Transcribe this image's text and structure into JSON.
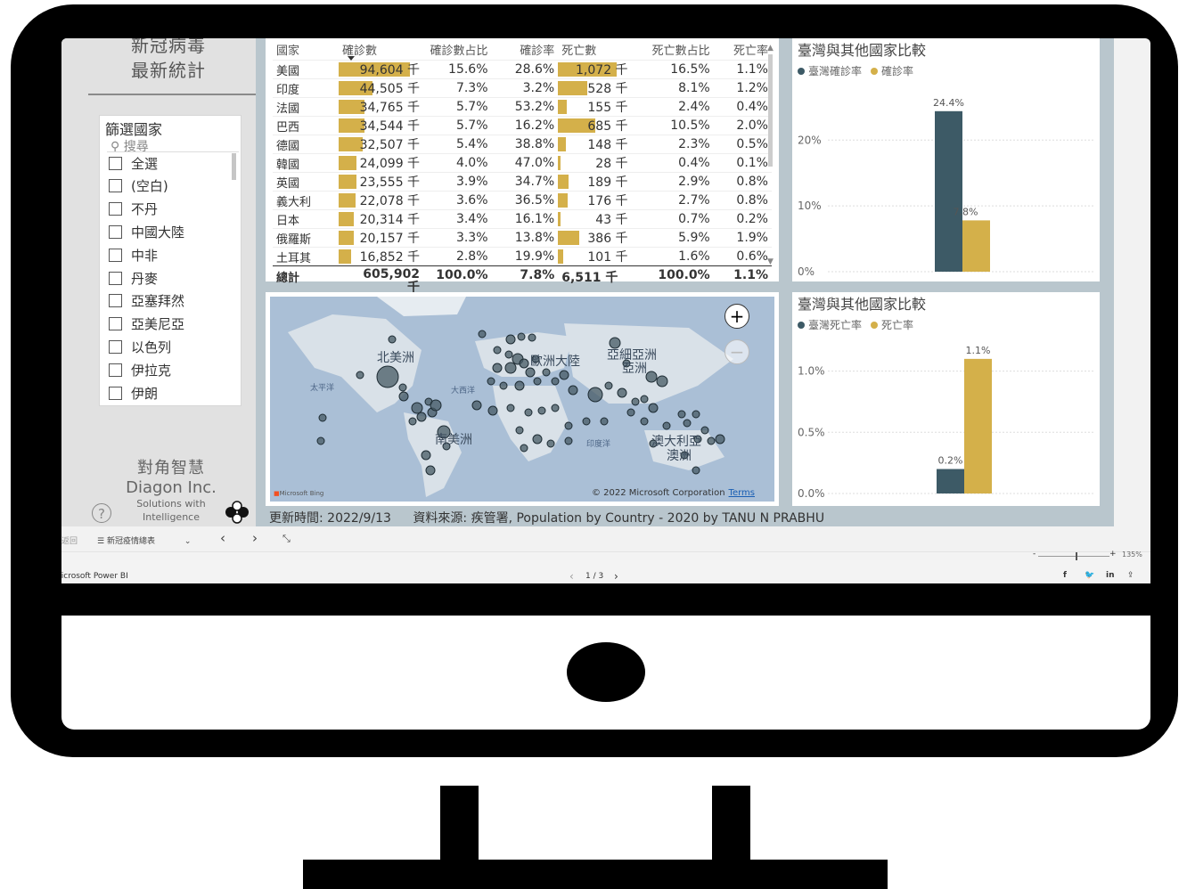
{
  "header": {
    "title_line1": "新冠病毒",
    "title_line2": "最新統計"
  },
  "slicer": {
    "title": "篩選國家",
    "search_placeholder": "搜尋",
    "items": [
      "全選",
      "(空白)",
      "不丹",
      "中國大陸",
      "中非",
      "丹麥",
      "亞塞拜然",
      "亞美尼亞",
      "以色列",
      "伊拉克",
      "伊朗"
    ]
  },
  "brand": {
    "cn": "對角智慧",
    "en": "Diagon Inc.",
    "tag1": "Solutions with",
    "tag2": "Intelligence"
  },
  "table": {
    "headers": [
      "國家",
      "確診數",
      "確診數占比",
      "確診率",
      "死亡數",
      "死亡數占比",
      "死亡率"
    ],
    "rows": [
      {
        "country": "美國",
        "cases": "94,604 千",
        "cases_pct": "15.6%",
        "case_rate": "28.6%",
        "deaths": "1,072 千",
        "deaths_pct": "16.5%",
        "death_rate": "1.1%",
        "cases_num": 94604,
        "deaths_num": 1072
      },
      {
        "country": "印度",
        "cases": "44,505 千",
        "cases_pct": "7.3%",
        "case_rate": "3.2%",
        "deaths": "528 千",
        "deaths_pct": "8.1%",
        "death_rate": "1.2%",
        "cases_num": 44505,
        "deaths_num": 528
      },
      {
        "country": "法國",
        "cases": "34,765 千",
        "cases_pct": "5.7%",
        "case_rate": "53.2%",
        "deaths": "155 千",
        "deaths_pct": "2.4%",
        "death_rate": "0.4%",
        "cases_num": 34765,
        "deaths_num": 155
      },
      {
        "country": "巴西",
        "cases": "34,544 千",
        "cases_pct": "5.7%",
        "case_rate": "16.2%",
        "deaths": "685 千",
        "deaths_pct": "10.5%",
        "death_rate": "2.0%",
        "cases_num": 34544,
        "deaths_num": 685
      },
      {
        "country": "德國",
        "cases": "32,507 千",
        "cases_pct": "5.4%",
        "case_rate": "38.8%",
        "deaths": "148 千",
        "deaths_pct": "2.3%",
        "death_rate": "0.5%",
        "cases_num": 32507,
        "deaths_num": 148
      },
      {
        "country": "韓國",
        "cases": "24,099 千",
        "cases_pct": "4.0%",
        "case_rate": "47.0%",
        "deaths": "28 千",
        "deaths_pct": "0.4%",
        "death_rate": "0.1%",
        "cases_num": 24099,
        "deaths_num": 28
      },
      {
        "country": "英國",
        "cases": "23,555 千",
        "cases_pct": "3.9%",
        "case_rate": "34.7%",
        "deaths": "189 千",
        "deaths_pct": "2.9%",
        "death_rate": "0.8%",
        "cases_num": 23555,
        "deaths_num": 189
      },
      {
        "country": "義大利",
        "cases": "22,078 千",
        "cases_pct": "3.6%",
        "case_rate": "36.5%",
        "deaths": "176 千",
        "deaths_pct": "2.7%",
        "death_rate": "0.8%",
        "cases_num": 22078,
        "deaths_num": 176
      },
      {
        "country": "日本",
        "cases": "20,314 千",
        "cases_pct": "3.4%",
        "case_rate": "16.1%",
        "deaths": "43 千",
        "deaths_pct": "0.7%",
        "death_rate": "0.2%",
        "cases_num": 20314,
        "deaths_num": 43
      },
      {
        "country": "俄羅斯",
        "cases": "20,157 千",
        "cases_pct": "3.3%",
        "case_rate": "13.8%",
        "deaths": "386 千",
        "deaths_pct": "5.9%",
        "death_rate": "1.9%",
        "cases_num": 20157,
        "deaths_num": 386
      },
      {
        "country": "土耳其",
        "cases": "16,852 千",
        "cases_pct": "2.8%",
        "case_rate": "19.9%",
        "deaths": "101 千",
        "deaths_pct": "1.6%",
        "death_rate": "0.6%",
        "cases_num": 16852,
        "deaths_num": 101
      }
    ],
    "total": {
      "label": "總計",
      "cases": "605,902",
      "cases_unit": "千",
      "cases_pct": "100.0%",
      "case_rate": "7.8%",
      "deaths": "6,511 千",
      "deaths_pct": "100.0%",
      "death_rate": "1.1%"
    }
  },
  "map": {
    "labels": {
      "na": "北美洲",
      "sa": "南美洲",
      "eu": "歐洲大陸",
      "as1": "亞細亞洲",
      "as2": "亞洲",
      "oc1": "澳大利亞",
      "oc2": "澳洲",
      "pac": "太平洋",
      "atl": "大西洋",
      "ind": "印度洋"
    },
    "zoom_in": "+",
    "zoom_out": "−",
    "copyright": "© 2022 Microsoft Corporation",
    "terms": "Terms",
    "bing": "Microsoft Bing"
  },
  "chart_data": [
    {
      "type": "bar",
      "title": "臺灣與其他國家比較",
      "series": [
        {
          "name": "臺灣確診率",
          "values": [
            24.4
          ]
        },
        {
          "name": "確診率",
          "values": [
            7.8
          ]
        }
      ],
      "data_labels": [
        "24.4%",
        "7.8%"
      ],
      "ylim": [
        0,
        26
      ],
      "yticks": [
        "0%",
        "10%",
        "20%"
      ],
      "grid": true,
      "legend": "top-left",
      "colors": [
        "#3d5a66",
        "#d4b04a"
      ]
    },
    {
      "type": "bar",
      "title": "臺灣與其他國家比較",
      "series": [
        {
          "name": "臺灣死亡率",
          "values": [
            0.2
          ]
        },
        {
          "name": "死亡率",
          "values": [
            1.1
          ]
        }
      ],
      "data_labels": [
        "0.2%",
        "1.1%"
      ],
      "ylim": [
        0,
        1.15
      ],
      "yticks": [
        "0.0%",
        "0.5%",
        "1.0%"
      ],
      "grid": true,
      "legend": "top-left",
      "colors": [
        "#3d5a66",
        "#d4b04a"
      ]
    }
  ],
  "footer": {
    "updated": "更新時間: 2022/9/13",
    "source": "資料來源: 疾管署, Population by Country - 2020 by TANU N PRABHU"
  },
  "pagebar": {
    "back": "返回",
    "page_select": "新冠疫情總表"
  },
  "status": {
    "app": "Microsoft Power BI",
    "page": "1 / 3",
    "zoom": "135%"
  }
}
